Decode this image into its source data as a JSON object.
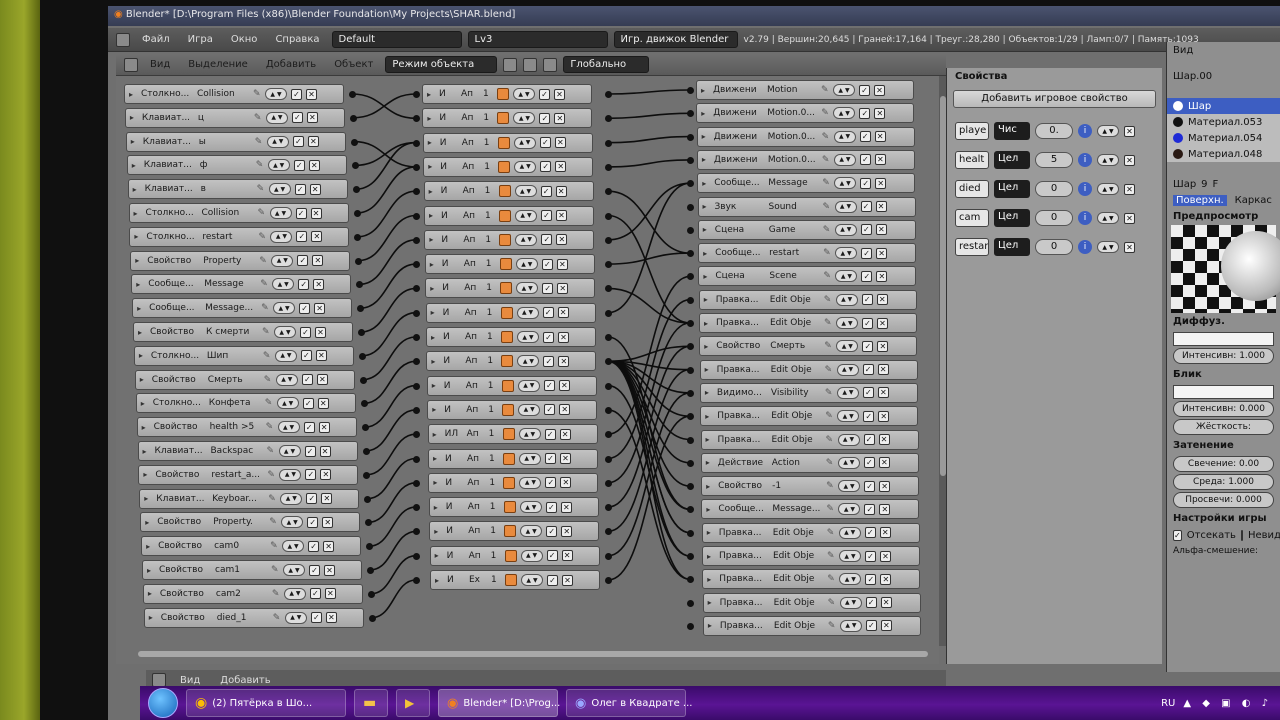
{
  "window": {
    "title": "Blender* [D:\\Program Files (x86)\\Blender Foundation\\My Projects\\SHAR.blend]"
  },
  "top_header": {
    "menus": [
      "Файл",
      "Игра",
      "Окно",
      "Справка"
    ],
    "layout": "Default",
    "scene": "Lv3",
    "engine": "Игр. движок Blender",
    "stats": "v2.79 | Вершин:20,645 | Граней:17,164 | Треуг.:28,280 | Объектов:1/29 | Ламп:0/7 | Память:1093"
  },
  "view_header": {
    "menus": [
      "Вид",
      "Выделение",
      "Добавить",
      "Объект"
    ],
    "mode": "Режим объекта",
    "orientation": "Глобально"
  },
  "sensors": [
    {
      "name": "Столкно...",
      "value": "Collision"
    },
    {
      "name": "Клавиат...",
      "value": "ц"
    },
    {
      "name": "Клавиат...",
      "value": "ы"
    },
    {
      "name": "Клавиат...",
      "value": "ф"
    },
    {
      "name": "Клавиат...",
      "value": "в"
    },
    {
      "name": "Столкно...",
      "value": "Collision"
    },
    {
      "name": "Столкно...",
      "value": "restart"
    },
    {
      "name": "Свойство",
      "value": "Property"
    },
    {
      "name": "Сообще...",
      "value": "Message"
    },
    {
      "name": "Сообще...",
      "value": "Message..."
    },
    {
      "name": "Свойство",
      "value": "К смерти"
    },
    {
      "name": "Столкно...",
      "value": "Шип"
    },
    {
      "name": "Свойство",
      "value": "Смерть"
    },
    {
      "name": "Столкно...",
      "value": "Конфета"
    },
    {
      "name": "Свойство",
      "value": "health >5"
    },
    {
      "name": "Клавиат...",
      "value": "Backspac"
    },
    {
      "name": "Свойство",
      "value": "restart_a..."
    },
    {
      "name": "Клавиат...",
      "value": "Keyboar..."
    },
    {
      "name": "Свойство",
      "value": "Property."
    },
    {
      "name": "Свойство",
      "value": "cam0"
    },
    {
      "name": "Свойство",
      "value": "cam1"
    },
    {
      "name": "Свойство",
      "value": "cam2"
    },
    {
      "name": "Свойство",
      "value": "died_1"
    }
  ],
  "controllers": [
    {
      "type": "И",
      "name": "Ап",
      "n": "1"
    },
    {
      "type": "И",
      "name": "Ап",
      "n": "1"
    },
    {
      "type": "И",
      "name": "Ап",
      "n": "1"
    },
    {
      "type": "И",
      "name": "Ап",
      "n": "1"
    },
    {
      "type": "И",
      "name": "Ап",
      "n": "1"
    },
    {
      "type": "И",
      "name": "Ап",
      "n": "1"
    },
    {
      "type": "И",
      "name": "Ап",
      "n": "1"
    },
    {
      "type": "И",
      "name": "Ап",
      "n": "1"
    },
    {
      "type": "И",
      "name": "Ап",
      "n": "1"
    },
    {
      "type": "И",
      "name": "Ап",
      "n": "1"
    },
    {
      "type": "И",
      "name": "Ап",
      "n": "1"
    },
    {
      "type": "И",
      "name": "Ап",
      "n": "1"
    },
    {
      "type": "И",
      "name": "Ап",
      "n": "1"
    },
    {
      "type": "И",
      "name": "Ап",
      "n": "1"
    },
    {
      "type": "ИЛ",
      "name": "Ап",
      "n": "1"
    },
    {
      "type": "И",
      "name": "Ап",
      "n": "1"
    },
    {
      "type": "И",
      "name": "Ап",
      "n": "1"
    },
    {
      "type": "И",
      "name": "Ап",
      "n": "1"
    },
    {
      "type": "И",
      "name": "Ап",
      "n": "1"
    },
    {
      "type": "И",
      "name": "Ап",
      "n": "1"
    },
    {
      "type": "И",
      "name": "Ex",
      "n": "1"
    }
  ],
  "actuators": [
    {
      "name": "Движени",
      "value": "Motion"
    },
    {
      "name": "Движени",
      "value": "Motion.0..."
    },
    {
      "name": "Движени",
      "value": "Motion.0..."
    },
    {
      "name": "Движени",
      "value": "Motion.0..."
    },
    {
      "name": "Сообще...",
      "value": "Message"
    },
    {
      "name": "Звук",
      "value": "Sound"
    },
    {
      "name": "Сцена",
      "value": "Game"
    },
    {
      "name": "Сообще...",
      "value": "restart"
    },
    {
      "name": "Сцена",
      "value": "Scene"
    },
    {
      "name": "Правка...",
      "value": "Edit Obje"
    },
    {
      "name": "Правка...",
      "value": "Edit Obje"
    },
    {
      "name": "Свойство",
      "value": "Смерть"
    },
    {
      "name": "Правка...",
      "value": "Edit Obje"
    },
    {
      "name": "Видимо...",
      "value": "Visibility"
    },
    {
      "name": "Правка...",
      "value": "Edit Obje"
    },
    {
      "name": "Правка...",
      "value": "Edit Obje"
    },
    {
      "name": "Действие",
      "value": "Action"
    },
    {
      "name": "Свойство",
      "value": "-1"
    },
    {
      "name": "Сообще...",
      "value": "Message..."
    },
    {
      "name": "Правка...",
      "value": "Edit Obje"
    },
    {
      "name": "Правка...",
      "value": "Edit Obje"
    },
    {
      "name": "Правка...",
      "value": "Edit Obje"
    },
    {
      "name": "Правка...",
      "value": "Edit Obje"
    },
    {
      "name": "Правка...",
      "value": "Edit Obje"
    }
  ],
  "bottom_header": {
    "menus": [
      "Вид",
      "Добавить"
    ]
  },
  "properties": {
    "title": "Свойства",
    "add_label": "Добавить игровое свойство",
    "items": [
      {
        "name": "playe",
        "type": "Чис",
        "value": "0."
      },
      {
        "name": "healt",
        "type": "Цел",
        "value": "5"
      },
      {
        "name": "died",
        "type": "Цел",
        "value": "0"
      },
      {
        "name": "cam",
        "type": "Цел",
        "value": "0"
      },
      {
        "name": "restar",
        "type": "Цел",
        "value": "0"
      }
    ]
  },
  "right_panel": {
    "menu": "Вид",
    "active_object": "Шар.00",
    "materials": [
      {
        "name": "Шар",
        "color": "#ffffff"
      },
      {
        "name": "Материал.053",
        "color": "#111111"
      },
      {
        "name": "Материал.054",
        "color": "#1f2bd6"
      },
      {
        "name": "Материал.048",
        "color": "#2a1a14"
      }
    ],
    "material_field": "Шар",
    "material_users": "9",
    "material_fake": "F",
    "tabs": [
      "Поверхн.",
      "Каркас"
    ],
    "preview": "Предпросмотр",
    "diffuse": "Диффуз.",
    "diffuse_intensity": "Интенсивн: 1.000",
    "specular": "Блик",
    "specular_intensity": "Интенсивн: 0.000",
    "hardness": "Жёсткость:",
    "shading": "Затенение",
    "emit": "Свечение:  0.00",
    "ambient": "Среда:  1.000",
    "translucency": "Просвечи:  0.000",
    "game_settings": "Настройки игры",
    "backface": "Отсекать",
    "invisible": "Невид",
    "alpha_blend": "Альфа-смешение:"
  },
  "taskbar": {
    "items": [
      "(2) Пятёрка в Шо...",
      "Blender* [D:\\Prog...",
      "Олег в Квадрате ..."
    ],
    "lang": "RU"
  }
}
